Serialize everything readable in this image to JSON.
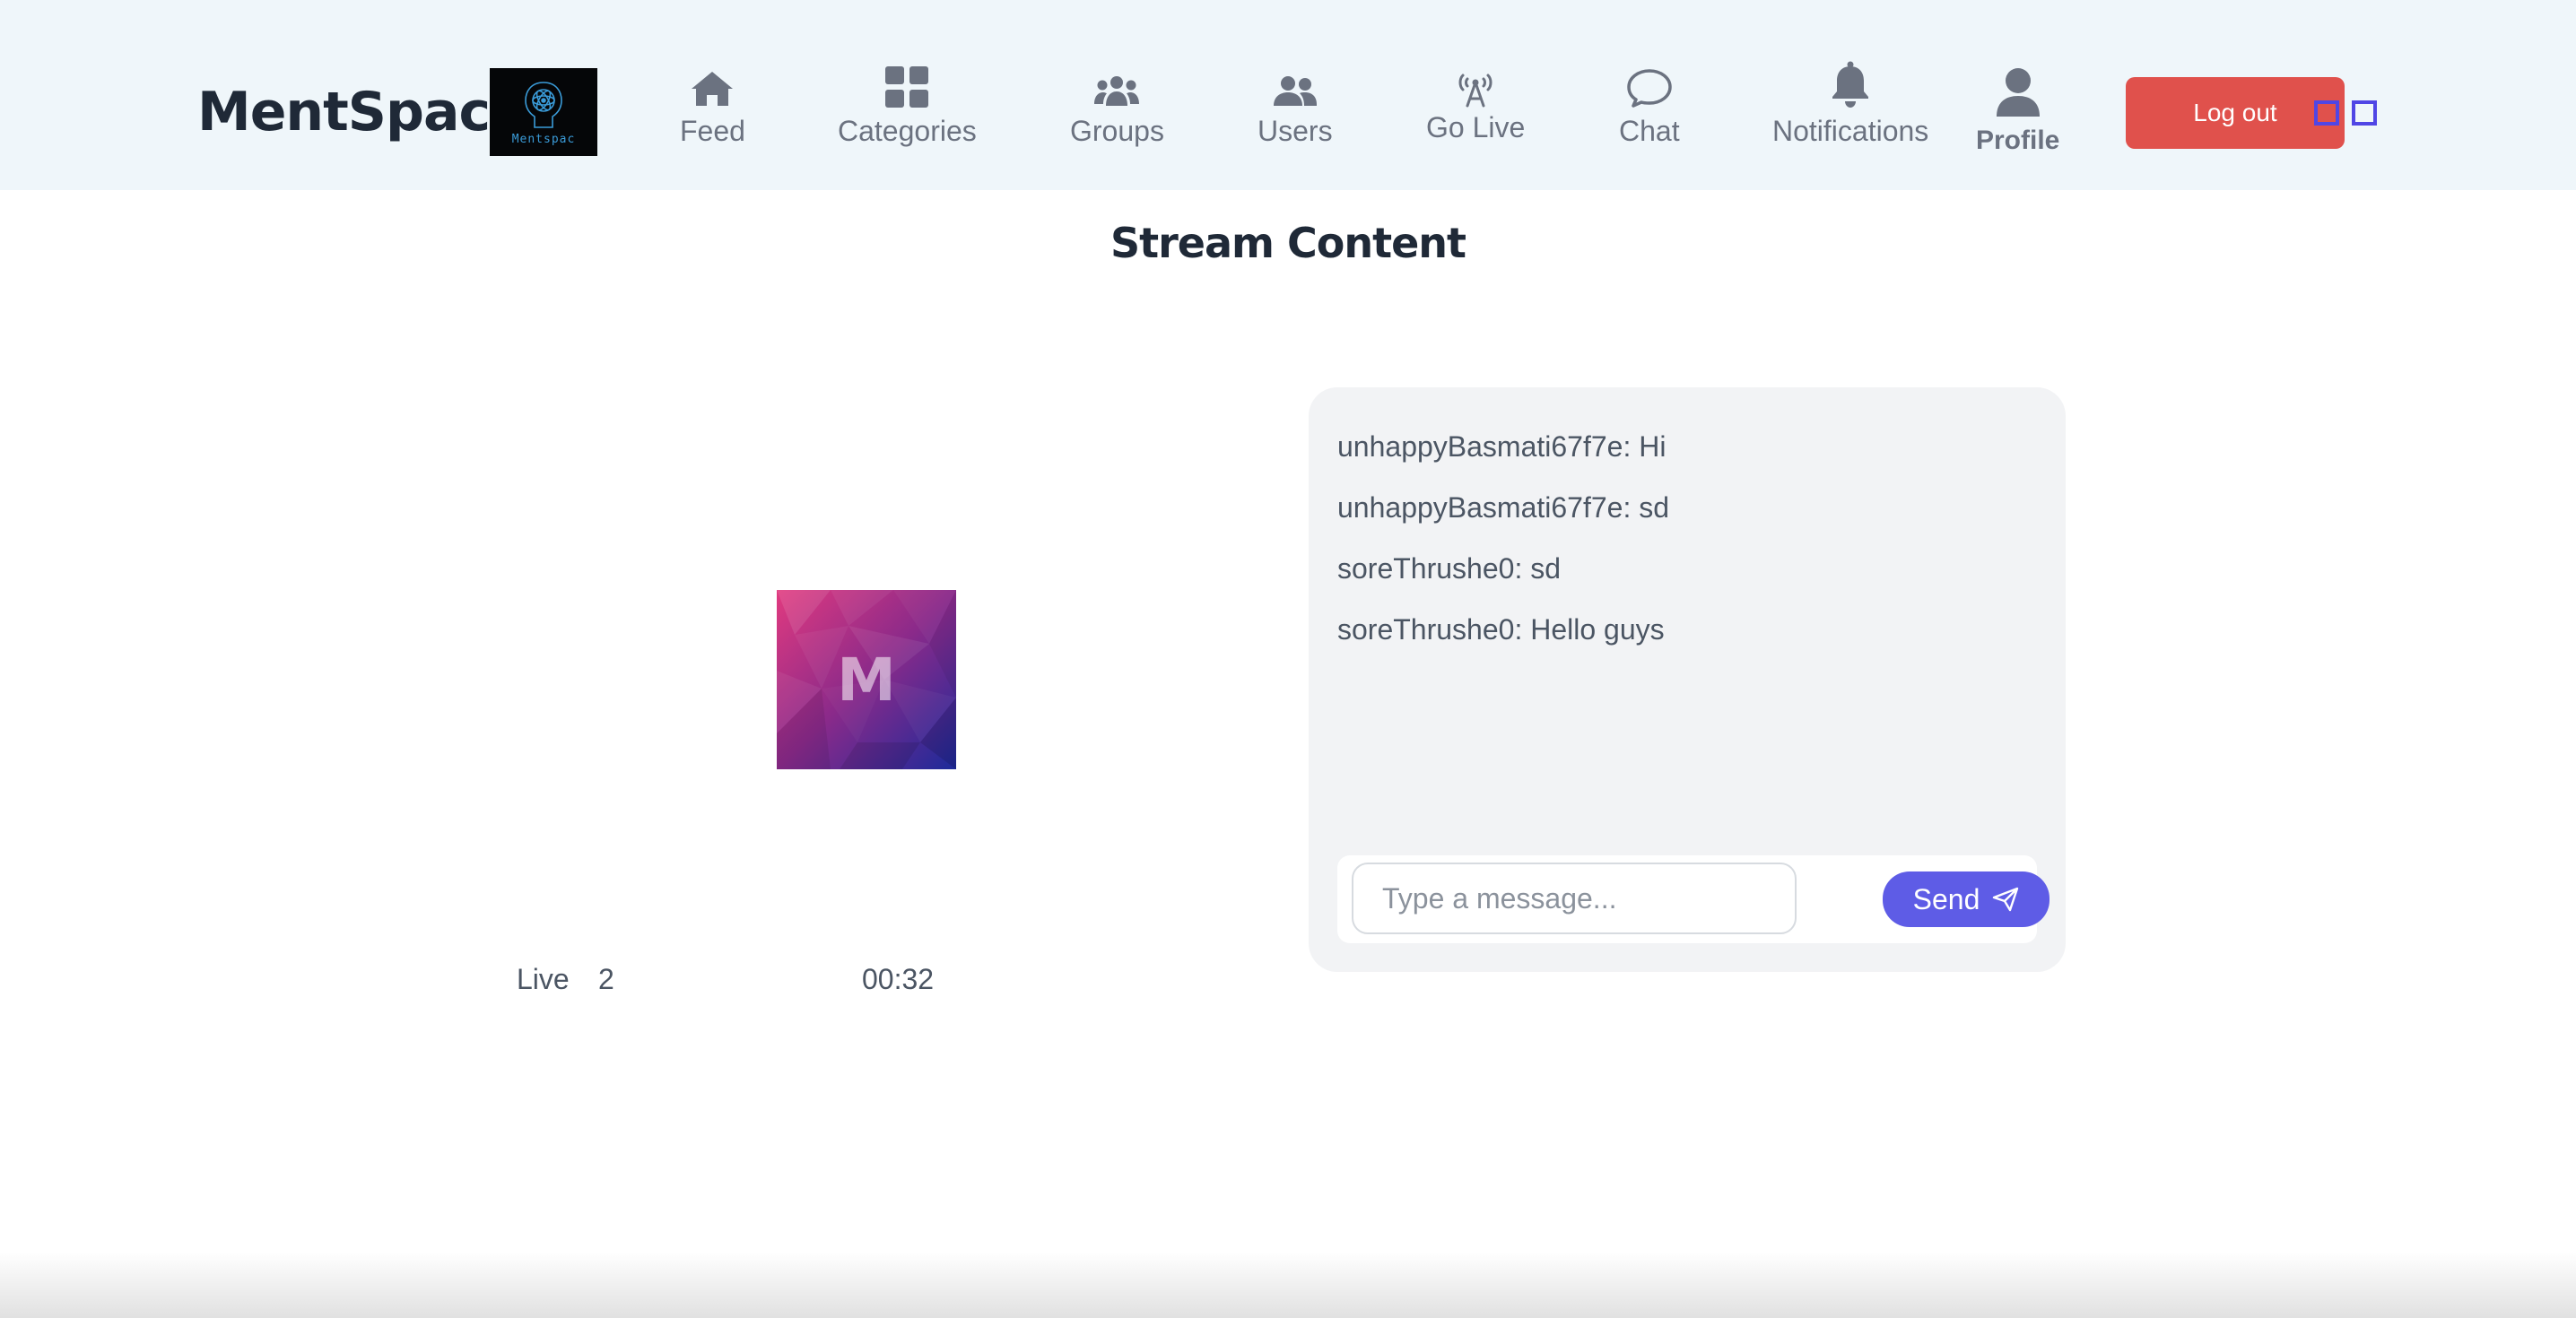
{
  "header": {
    "brand_name": "MentSpac",
    "logo_caption": "Mentspac",
    "nav": [
      {
        "label": "Feed",
        "icon": "home-icon"
      },
      {
        "label": "Categories",
        "icon": "grid-icon"
      },
      {
        "label": "Groups",
        "icon": "users-group-icon"
      },
      {
        "label": "Users",
        "icon": "users-icon"
      },
      {
        "label": "Go Live",
        "icon": "broadcast-icon"
      },
      {
        "label": "Chat",
        "icon": "chat-bubble-icon"
      },
      {
        "label": "Notifications",
        "icon": "bell-icon"
      },
      {
        "label": "Profile",
        "icon": "user-icon"
      }
    ],
    "logout_label": "Log out"
  },
  "main": {
    "title": "Stream Content",
    "stream": {
      "avatar_letter": "M",
      "live_label": "Live",
      "viewer_count": "2",
      "elapsed": "00:32"
    },
    "chat": {
      "messages": [
        "unhappyBasmati67f7e: Hi",
        "unhappyBasmati67f7e: sd",
        "soreThrushe0: sd",
        "soreThrushe0: Hello guys"
      ],
      "input_placeholder": "Type a message...",
      "send_label": "Send"
    }
  },
  "colors": {
    "header_bg": "#eff6fa",
    "logout_bg": "#e0514c",
    "send_bg": "#5e5ce6",
    "chat_bg": "#f2f3f5",
    "accent_outline": "#5046e5"
  }
}
